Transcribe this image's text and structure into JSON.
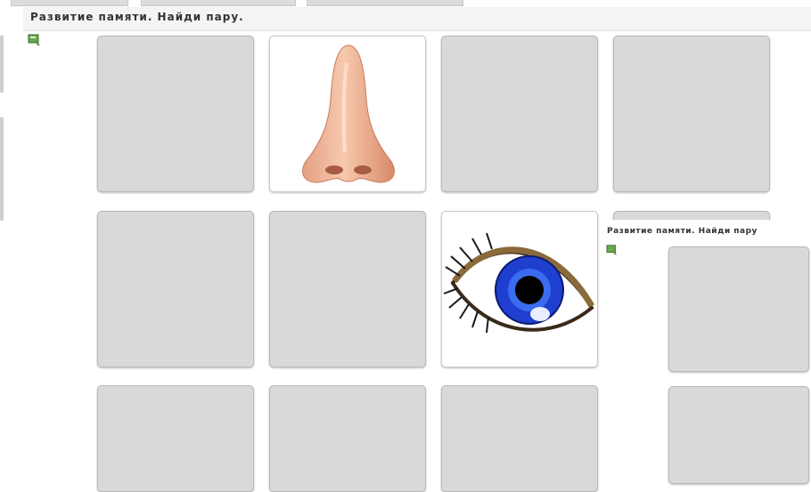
{
  "game": {
    "title": "Развитие памяти. Найди пару.",
    "help_icon": "help-icon"
  },
  "board": {
    "cards": [
      {
        "state": "hidden"
      },
      {
        "state": "revealed",
        "image": "nose-icon"
      },
      {
        "state": "hidden"
      },
      {
        "state": "hidden"
      },
      {
        "state": "hidden"
      },
      {
        "state": "hidden"
      },
      {
        "state": "revealed",
        "image": "eye-icon"
      },
      {
        "state": "hidden"
      },
      {
        "state": "hidden"
      },
      {
        "state": "hidden"
      },
      {
        "state": "hidden"
      }
    ]
  },
  "popup": {
    "title": "Развитие памяти. Найди пару",
    "help_icon": "help-icon",
    "cards": [
      {
        "state": "hidden"
      },
      {
        "state": "hidden"
      }
    ]
  },
  "colors": {
    "card_back": "#d9d9d9",
    "card_face": "#ffffff",
    "eye_iris": "#1e3fd0"
  }
}
